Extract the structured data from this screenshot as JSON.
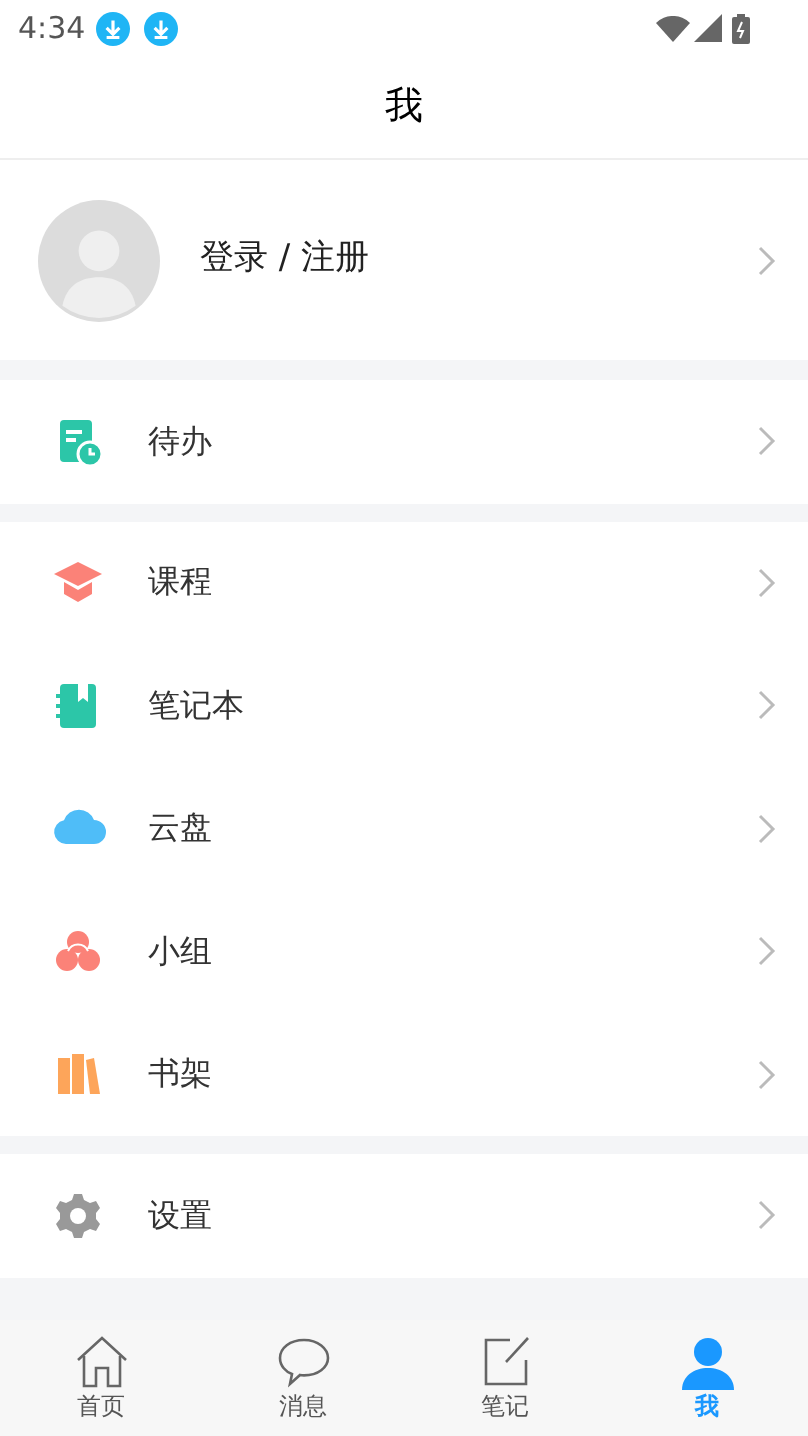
{
  "status_bar": {
    "time": "4:34"
  },
  "header": {
    "title": "我"
  },
  "profile": {
    "label": "登录 / 注册"
  },
  "menu_groups": [
    {
      "items": [
        {
          "kind": "todo",
          "label": "待办"
        }
      ]
    },
    {
      "items": [
        {
          "kind": "course",
          "label": "课程"
        },
        {
          "kind": "notebook",
          "label": "笔记本"
        },
        {
          "kind": "cloud",
          "label": "云盘"
        },
        {
          "kind": "group",
          "label": "小组"
        },
        {
          "kind": "bookshelf",
          "label": "书架"
        }
      ]
    },
    {
      "items": [
        {
          "kind": "settings",
          "label": "设置"
        }
      ]
    }
  ],
  "tabs": [
    {
      "kind": "home",
      "label": "首页",
      "selected": false
    },
    {
      "kind": "message",
      "label": "消息",
      "selected": false
    },
    {
      "kind": "note",
      "label": "笔记",
      "selected": false
    },
    {
      "kind": "me",
      "label": "我",
      "selected": true
    }
  ]
}
